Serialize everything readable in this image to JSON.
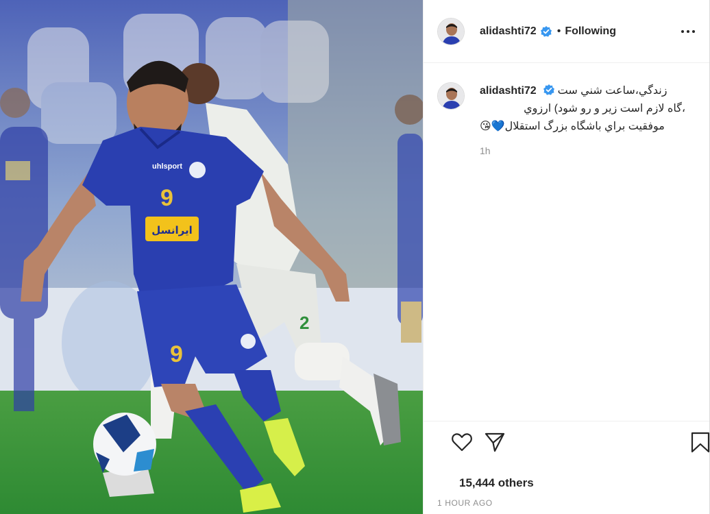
{
  "post": {
    "username": "alidashti72",
    "follow_status": "Following",
    "separator": "•",
    "caption": {
      "username": "alidashti72",
      "line1": "زندگي،ساعت شني ست",
      "line2": "،گاه لازم است زير و رو شود) ارزوي",
      "line3": "موفقيت براي باشگاه بزرگ استقلال",
      "emoji": "😘💙"
    },
    "relative_time": "1h",
    "likes_text": "15,444 others",
    "posted_time": "1 HOUR AGO"
  },
  "media": {
    "front_player_number": "9",
    "back_player_number": "2",
    "sponsor_text": "ایرانسل",
    "kit_brand": "uhlsport"
  },
  "colors": {
    "verified": "#3897f0",
    "pitch": "#2f8d36",
    "home_kit": "#2a3fb0",
    "away_kit": "#eceeea"
  },
  "icons": {
    "verified": "verified-badge-icon",
    "more": "more-options-icon",
    "like": "heart-icon",
    "share": "paper-plane-icon",
    "save": "bookmark-icon"
  }
}
